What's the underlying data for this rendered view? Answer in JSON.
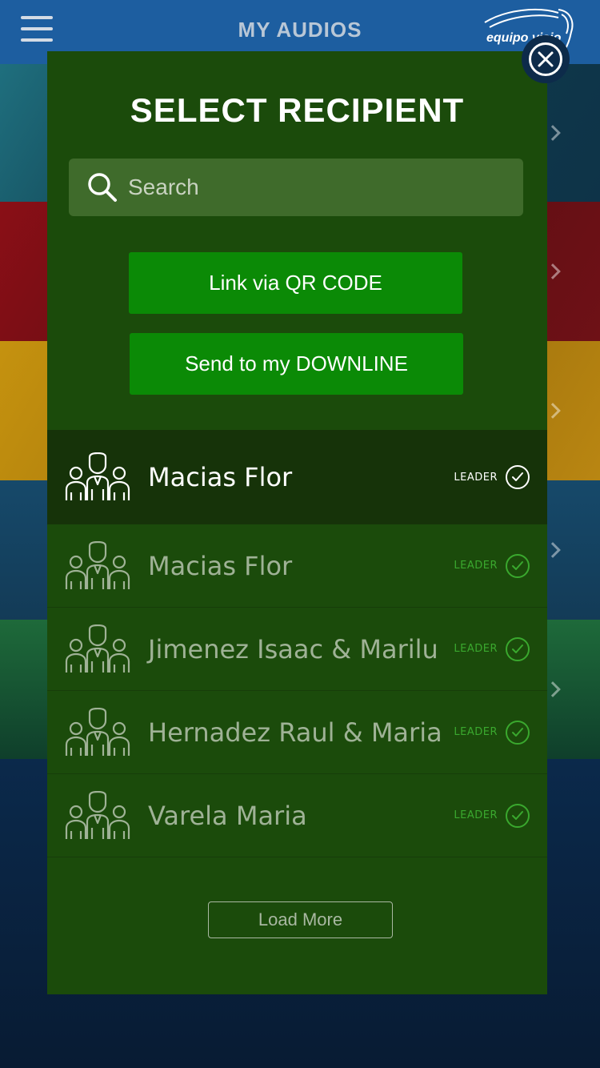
{
  "header": {
    "title": "MY AUDIOS",
    "brand": "equipo visio"
  },
  "modal": {
    "title": "SELECT RECIPIENT",
    "search_placeholder": "Search",
    "qr_button": "Link via QR CODE",
    "downline_button": "Send to my DOWNLINE",
    "load_more": "Load More",
    "recipients": [
      {
        "name": "Macias Flor",
        "badge": "LEADER",
        "selected": true
      },
      {
        "name": "Macias Flor",
        "badge": "LEADER",
        "selected": false
      },
      {
        "name": "Jimenez Isaac & Marilu",
        "badge": "LEADER",
        "selected": false
      },
      {
        "name": "Hernadez Raul & Maria",
        "badge": "LEADER",
        "selected": false
      },
      {
        "name": "Varela Maria",
        "badge": "LEADER",
        "selected": false
      }
    ]
  },
  "colors": {
    "modal_bg": "#1b4b0b",
    "button_green": "#0b8a06",
    "accent_green": "#3aa82e",
    "topbar": "#1d5ea0"
  }
}
